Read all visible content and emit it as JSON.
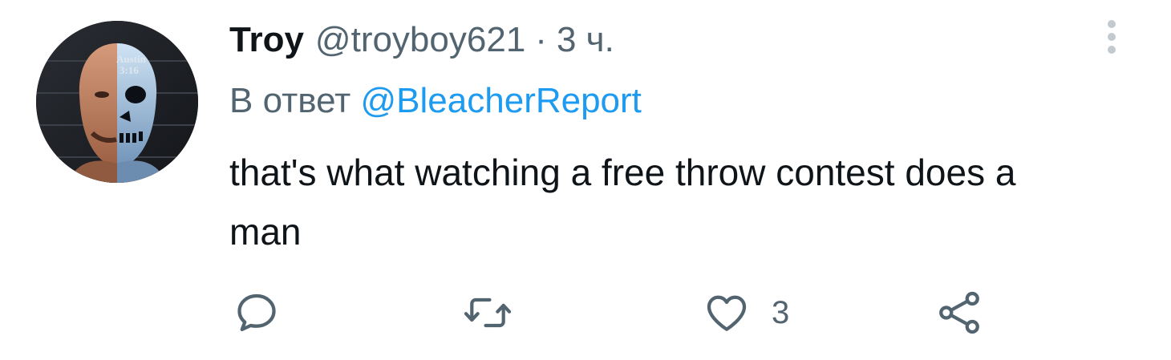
{
  "tweet": {
    "author_name": "Troy",
    "author_handle": "@troyboy621",
    "separator": "·",
    "time": "3 ч.",
    "reply_prefix": "В ответ",
    "reply_mention": "@BleacherReport",
    "text": "that's what watching a free throw contest does a man",
    "avatar_text_line1": "Austin",
    "avatar_text_line2": "3:16"
  },
  "actions": {
    "reply_icon": "reply-icon",
    "retweet_icon": "retweet-icon",
    "like_icon": "heart-icon",
    "like_count": "3",
    "share_icon": "share-icon"
  },
  "colors": {
    "text_primary": "#0f1419",
    "text_secondary": "#536471",
    "link": "#1d9bf0",
    "more_dots": "#c4c9cd"
  }
}
